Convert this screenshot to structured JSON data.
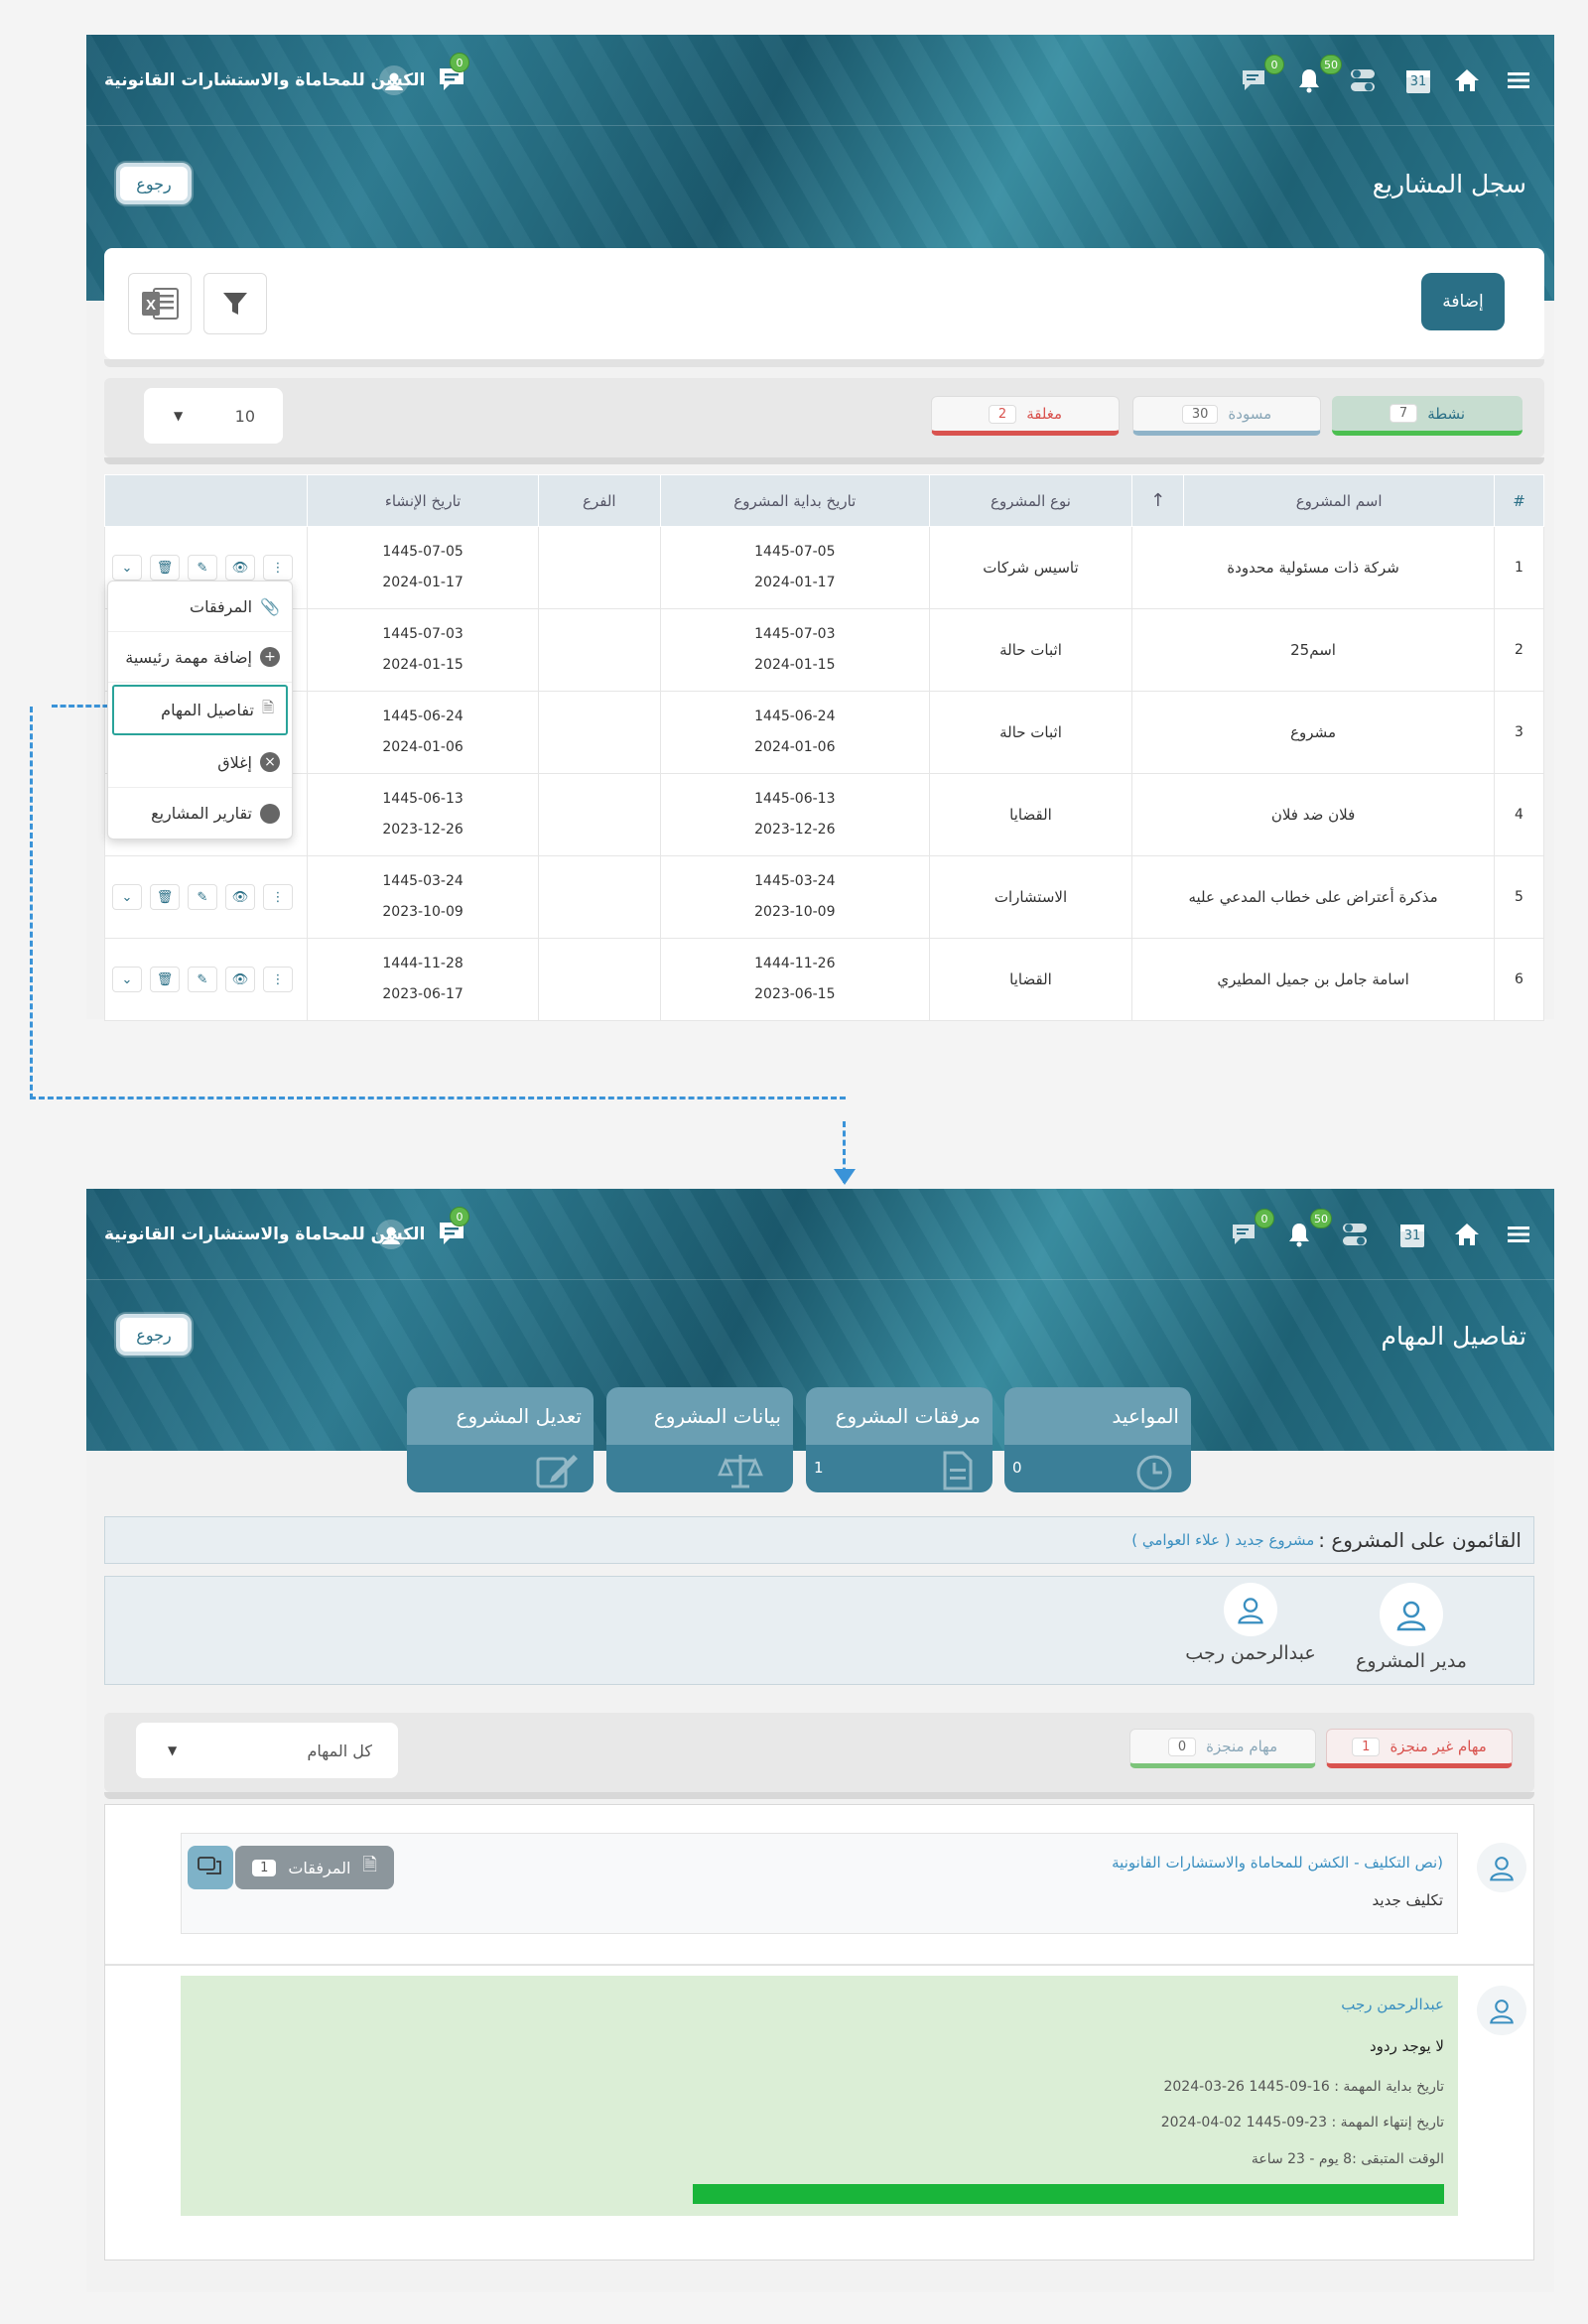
{
  "topbar": {
    "brand": "الكشن للمحاماة والاستشارات القانونية",
    "messages_badge": "0",
    "chat_badge": "0",
    "notifications_badge": "50",
    "calendar_day": "31"
  },
  "screen1": {
    "title": "سجل المشاريع",
    "back_label": "رجوع",
    "add_label": "إضافة",
    "tabs": [
      {
        "label": "نشطة",
        "count": "7",
        "color": "#4cbf50"
      },
      {
        "label": "مسودة",
        "count": "30",
        "color": "#8fb3c8"
      },
      {
        "label": "مغلقة",
        "count": "2",
        "color": "#d9534f"
      }
    ],
    "page_size": "10",
    "columns": [
      "#",
      "اسم المشروع",
      "",
      "نوع المشروع",
      "تاريخ بداية المشروع",
      "الفرع",
      "تاريخ الإنشاء",
      ""
    ],
    "rows": [
      {
        "num": "1",
        "name": "شركة ذات مسئولية محدودة",
        "type": "تاسيس شركات",
        "start_h": "1445-07-05",
        "start_g": "2024-01-17",
        "branch": "",
        "created_h": "1445-07-05",
        "created_g": "2024-01-17"
      },
      {
        "num": "2",
        "name": "اسم25",
        "type": "اثبات حالة",
        "start_h": "1445-07-03",
        "start_g": "2024-01-15",
        "branch": "",
        "created_h": "1445-07-03",
        "created_g": "2024-01-15"
      },
      {
        "num": "3",
        "name": "مشروع",
        "type": "اثبات حالة",
        "start_h": "1445-06-24",
        "start_g": "2024-01-06",
        "branch": "",
        "created_h": "1445-06-24",
        "created_g": "2024-01-06"
      },
      {
        "num": "4",
        "name": "فلان ضد فلان",
        "type": "القضايا",
        "start_h": "1445-06-13",
        "start_g": "2023-12-26",
        "branch": "",
        "created_h": "1445-06-13",
        "created_g": "2023-12-26"
      },
      {
        "num": "5",
        "name": "مذكرة أعتراض على خطاب المدعي عليه",
        "type": "الاستشارات",
        "start_h": "1445-03-24",
        "start_g": "2023-10-09",
        "branch": "",
        "created_h": "1445-03-24",
        "created_g": "2023-10-09"
      },
      {
        "num": "6",
        "name": "اسامة جامل بن جميل المطيري",
        "type": "القضايا",
        "start_h": "1444-11-26",
        "start_g": "2023-06-15",
        "branch": "",
        "created_h": "1444-11-28",
        "created_g": "2023-06-17"
      }
    ],
    "dropdown_menu": [
      "المرفقات",
      "إضافة مهمة رئيسية",
      "تفاصيل المهام",
      "إغلاق",
      "تقارير المشاريع"
    ]
  },
  "screen2": {
    "title": "تفاصيل المهام",
    "back_label": "رجوع",
    "cards": [
      {
        "label": "المواعيد",
        "value": "0",
        "icon": "clock-icon"
      },
      {
        "label": "مرفقات المشروع",
        "value": "1",
        "icon": "document-icon"
      },
      {
        "label": "بيانات المشروع",
        "value": "",
        "icon": "scales-icon"
      },
      {
        "label": "تعديل المشروع",
        "value": "",
        "icon": "edit-icon"
      }
    ],
    "managers_label": "القائمون على المشروع :",
    "managers_value": "مشروع جديد ( علاء العوامي )",
    "people": [
      {
        "name": "مدير المشروع"
      },
      {
        "name": "عبدالرحمن رجب"
      }
    ],
    "task_tabs": [
      {
        "label": "مهام غير منجزة",
        "count": "1",
        "color": "#d9534f"
      },
      {
        "label": "مهام منجزة",
        "count": "0",
        "color": "#7cc47a"
      }
    ],
    "task_filter": "كل المهام",
    "assignment": {
      "header": "(نص التكليف - الكشن للمحاماة والاستشارات القانونية",
      "body": "تكليف جديد",
      "attachments_label": "المرفقات",
      "attachments_count": "1"
    },
    "reply": {
      "name": "عبدالرحمن رجب",
      "text": "لا يوجد ردود",
      "start": "تاريخ بداية المهمة : 16-09-1445 26-03-2024",
      "end": "تاريخ إنتهاء المهمة : 23-09-1445 02-04-2024",
      "remaining": "الوقت المتبقى :8 يوم - 23 ساعة",
      "progress": 1.0,
      "progress_color": "#19b53a"
    }
  }
}
